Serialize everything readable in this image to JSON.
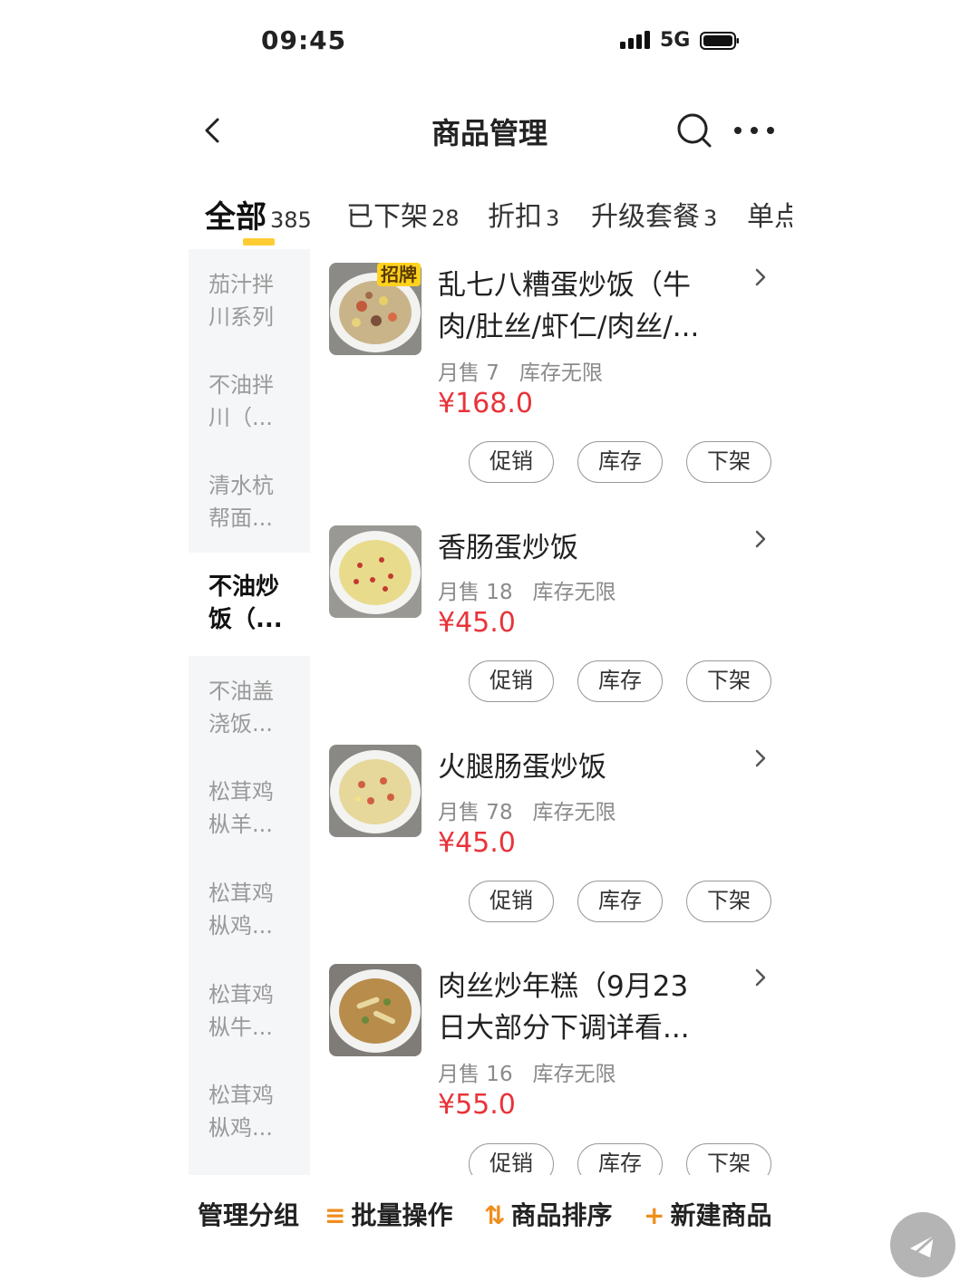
{
  "status_bar": {
    "time": "09:45",
    "network": "5G"
  },
  "nav": {
    "title": "商品管理"
  },
  "tabs": [
    {
      "label": "全部",
      "count": "385"
    },
    {
      "label": "已下架",
      "count": "28"
    },
    {
      "label": "折扣",
      "count": "3"
    },
    {
      "label": "升级套餐",
      "count": "3"
    },
    {
      "label": "单点",
      "count": ""
    }
  ],
  "sidebar": {
    "items": [
      {
        "line1": "茄汁拌",
        "line2": "川系列"
      },
      {
        "line1": "不油拌",
        "line2": "川（..."
      },
      {
        "line1": "清水杭",
        "line2": "帮面..."
      },
      {
        "line1": "不油炒",
        "line2": "饭（..."
      },
      {
        "line1": "不油盖",
        "line2": "浇饭..."
      },
      {
        "line1": "松茸鸡",
        "line2": "枞羊..."
      },
      {
        "line1": "松茸鸡",
        "line2": "枞鸡..."
      },
      {
        "line1": "松茸鸡",
        "line2": "枞牛..."
      },
      {
        "line1": "松茸鸡",
        "line2": "枞鸡..."
      }
    ]
  },
  "products": [
    {
      "badge": "招牌",
      "name_line1": "乱七八糟蛋炒饭（牛",
      "name_line2": "肉/肚丝/虾仁/肉丝/...",
      "sales": "月售 7",
      "stock": "库存无限",
      "price": "¥168.0"
    },
    {
      "name_line1": "香肠蛋炒饭",
      "sales": "月售 18",
      "stock": "库存无限",
      "price": "¥45.0"
    },
    {
      "name_line1": "火腿肠蛋炒饭",
      "sales": "月售 78",
      "stock": "库存无限",
      "price": "¥45.0"
    },
    {
      "name_line1": "肉丝炒年糕（9月23",
      "name_line2": "日大部分下调详看...",
      "sales": "月售 16",
      "stock": "库存无限",
      "price": "¥55.0"
    }
  ],
  "actions": {
    "promo": "促销",
    "stock": "库存",
    "delist": "下架"
  },
  "bottom_bar": {
    "manage_group": "管理分组",
    "batch": "批量操作",
    "sort": "商品排序",
    "new_item": "新建商品",
    "batch_icon": "≡",
    "sort_icon": "⇅",
    "new_icon": "+"
  },
  "colors": {
    "accent": "#ffcc33",
    "price": "#e8333a",
    "action_icon": "#f08d1c"
  },
  "icons": [
    "back-arrow-icon",
    "search-icon",
    "more-icon",
    "chevron-right-icon",
    "signal-icon",
    "battery-icon",
    "float-share-icon"
  ]
}
